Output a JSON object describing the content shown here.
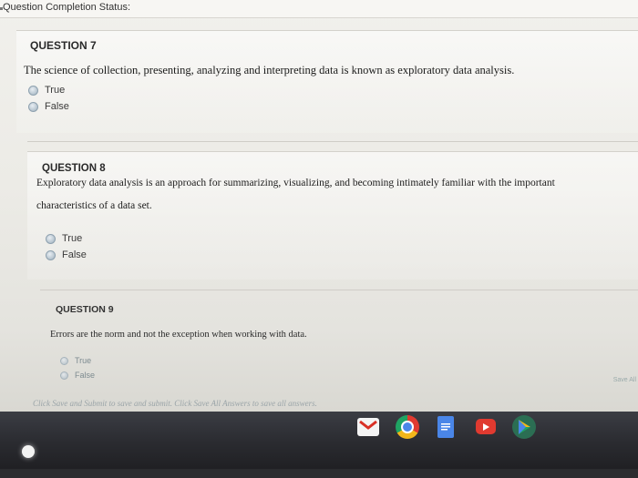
{
  "status": {
    "label": "Question Completion Status:"
  },
  "questions": [
    {
      "heading": "QUESTION 7",
      "text": "The science of collection, presenting, analyzing and interpreting data is known as exploratory data analysis.",
      "options": [
        "True",
        "False"
      ]
    },
    {
      "heading": "QUESTION 8",
      "text_line1": "Exploratory data analysis is an approach for summarizing, visualizing, and becoming intimately familiar with the important",
      "text_line2": "characteristics of a data set.",
      "options": [
        "True",
        "False"
      ]
    },
    {
      "heading": "QUESTION 9",
      "text": "Errors are the norm and not the exception when working with data.",
      "options": [
        "True",
        "False"
      ]
    }
  ],
  "footer": {
    "instruction": "Click Save and Submit to save and submit. Click Save All Answers to save all answers.",
    "save_all": "Save All"
  },
  "shelf": {
    "icons": [
      "launcher-icon",
      "gmail-icon",
      "chrome-icon",
      "docs-icon",
      "youtube-icon",
      "play-store-icon"
    ],
    "colors": {
      "gmail": "#ffffff",
      "chrome": "#f2b61a",
      "docs": "#4a86e8",
      "youtube": "#e03a30",
      "play": "#1fa463"
    }
  }
}
